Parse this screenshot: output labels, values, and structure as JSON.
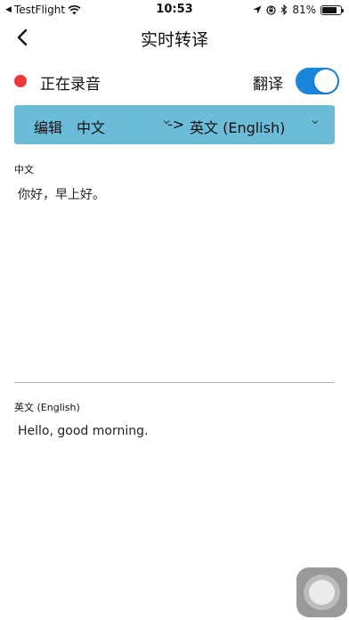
{
  "status_bar": {
    "back_app": "TestFlight",
    "time": "10:53",
    "battery": "81%",
    "battery_level": 0.81
  },
  "nav": {
    "title": "实时转译"
  },
  "record": {
    "status_label": "正在录音",
    "translate_label": "翻译",
    "translate_on": true,
    "colors": {
      "dot": "#f0383b",
      "toggle": "#1a86db"
    }
  },
  "lang_bar": {
    "edit_label": "编辑",
    "source": "中文",
    "arrow": "->",
    "target": "英文 (English)",
    "color": "#6cbcd9"
  },
  "source_section": {
    "label": "中文",
    "text": "你好，早上好。"
  },
  "target_section": {
    "label": "英文 (English)",
    "text": "Hello, good morning."
  }
}
